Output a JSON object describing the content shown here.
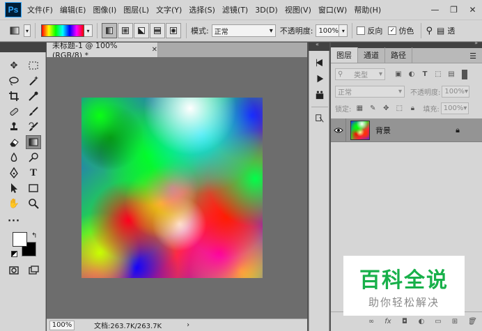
{
  "app": {
    "logo": "Ps"
  },
  "menu": [
    "文件(F)",
    "编辑(E)",
    "图像(I)",
    "图层(L)",
    "文字(Y)",
    "选择(S)",
    "滤镜(T)",
    "3D(D)",
    "视图(V)",
    "窗口(W)",
    "帮助(H)"
  ],
  "window_controls": {
    "minimize": "—",
    "restore": "❐",
    "close": "✕"
  },
  "options": {
    "mode_label": "模式:",
    "mode_value": "正常",
    "opacity_label": "不透明度:",
    "opacity_value": "100%",
    "reverse_label": "反向",
    "dither_label": "仿色",
    "transparency_label": "透"
  },
  "document": {
    "tab_title": "未标题-1 @ 100%(RGB/8) *",
    "zoom": "100%",
    "doc_info": "文档:263.7K/263.7K",
    "status_arrow": "›"
  },
  "layers_panel": {
    "tabs": [
      "图层",
      "通道",
      "路径"
    ],
    "kind_filter": "类型",
    "blend_mode": "正常",
    "opacity_label": "不透明度:",
    "opacity_value": "100%",
    "lock_label": "锁定:",
    "fill_label": "填充:",
    "fill_value": "100%",
    "layers": [
      {
        "name": "背景",
        "visible": true,
        "locked": true
      }
    ]
  },
  "watermark": {
    "title": "百科全说",
    "subtitle": "助你轻松解决"
  }
}
